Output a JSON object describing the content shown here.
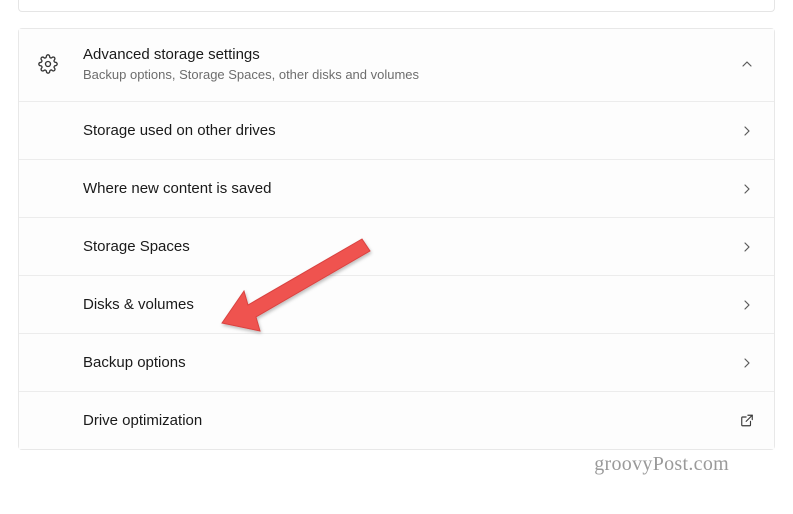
{
  "header": {
    "title": "Advanced storage settings",
    "subtitle": "Backup options, Storage Spaces, other disks and volumes"
  },
  "items": [
    {
      "label": "Storage used on other drives",
      "action": "chevron"
    },
    {
      "label": "Where new content is saved",
      "action": "chevron"
    },
    {
      "label": "Storage Spaces",
      "action": "chevron"
    },
    {
      "label": "Disks & volumes",
      "action": "chevron"
    },
    {
      "label": "Backup options",
      "action": "chevron"
    },
    {
      "label": "Drive optimization",
      "action": "external"
    }
  ],
  "watermark": "groovyPost.com"
}
